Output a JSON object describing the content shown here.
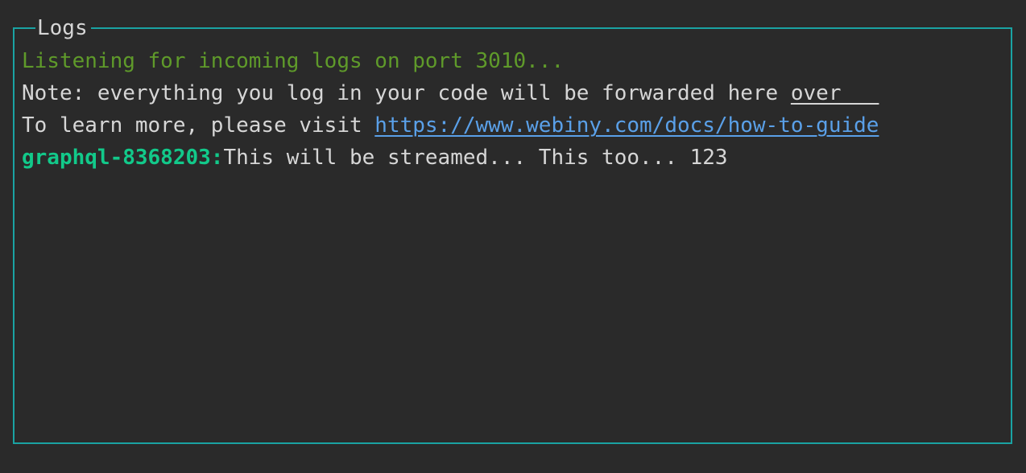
{
  "panel": {
    "title": "Logs"
  },
  "logs": {
    "listening": "Listening for incoming logs on port 3010...",
    "note_prefix": "Note: everything you log in your code will be forwarded here ",
    "note_tail": "over   ",
    "learn_prefix": "To learn more, please visit ",
    "learn_url": "https://www.webiny.com/docs/how-to-guide",
    "entry": {
      "source": "graphql-8368203:",
      "message": "This will be streamed... This too... 123"
    }
  },
  "colors": {
    "background": "#2a2a2a",
    "border": "#1aa3a3",
    "info_text": "#5f9a2a",
    "link": "#5aa0e8",
    "source_label": "#12c98a",
    "text": "#d6d6d6"
  }
}
